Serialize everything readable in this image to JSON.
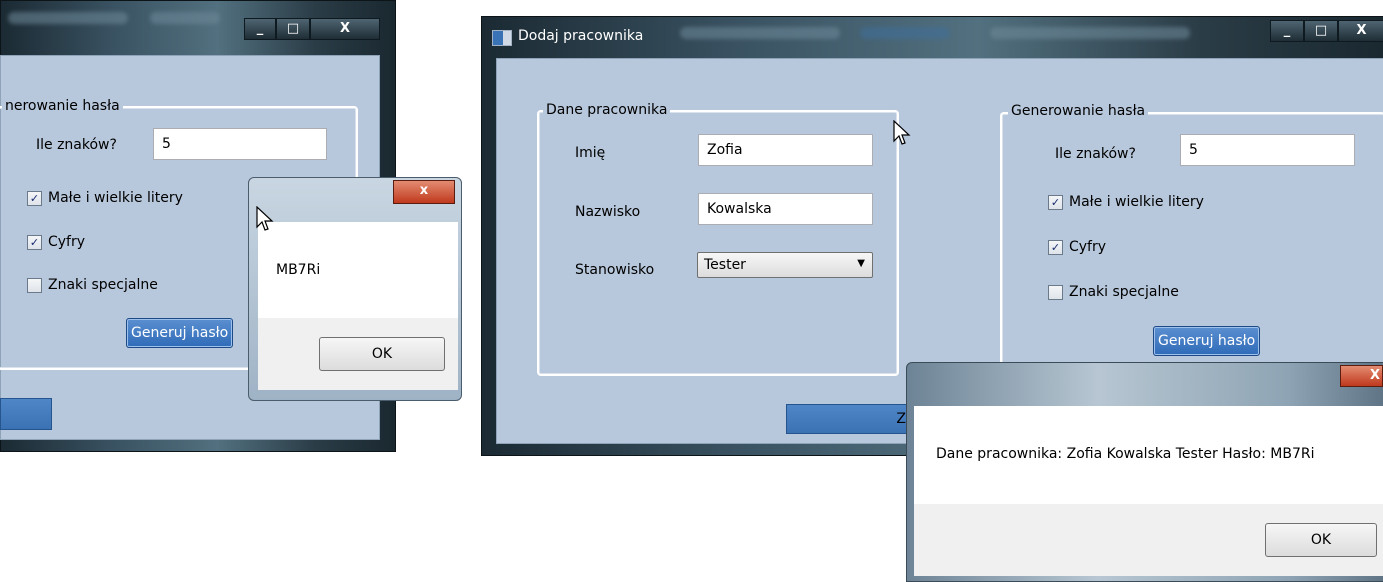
{
  "left_window": {
    "group_title": "nerowanie hasła",
    "length_label": "Ile znaków?",
    "length_value": "5",
    "opt_letters": "Małe i wielkie litery",
    "opt_digits": "Cyfry",
    "opt_special": "Znaki specjalne",
    "letters_checked": "✓",
    "digits_checked": "✓",
    "generate_button": "Generuj hasło",
    "caption_min": "_",
    "caption_max": "□",
    "caption_close": "X"
  },
  "left_message": {
    "text": "MB7Ri",
    "ok": "OK",
    "close": "x"
  },
  "main_window": {
    "title": "Dodaj pracownika",
    "employee_group": "Dane pracownika",
    "first_name_label": "Imię",
    "first_name_value": "Zofia",
    "last_name_label": "Nazwisko",
    "last_name_value": "Kowalska",
    "position_label": "Stanowisko",
    "position_value": "Tester",
    "password_group": "Generowanie hasła",
    "length_label": "Ile znaków?",
    "length_value": "5",
    "opt_letters": "Małe i wielkie litery",
    "opt_digits": "Cyfry",
    "opt_special": "Znaki specjalne",
    "letters_checked": "✓",
    "digits_checked": "✓",
    "generate_button": "Generuj hasło",
    "save_button_partial": "Z",
    "caption_min": "_",
    "caption_max": "□",
    "caption_close": "X"
  },
  "right_message": {
    "text": "Dane pracownika: Zofia Kowalska Tester Hasło: MB7Ri",
    "ok": "OK",
    "close": "X"
  }
}
